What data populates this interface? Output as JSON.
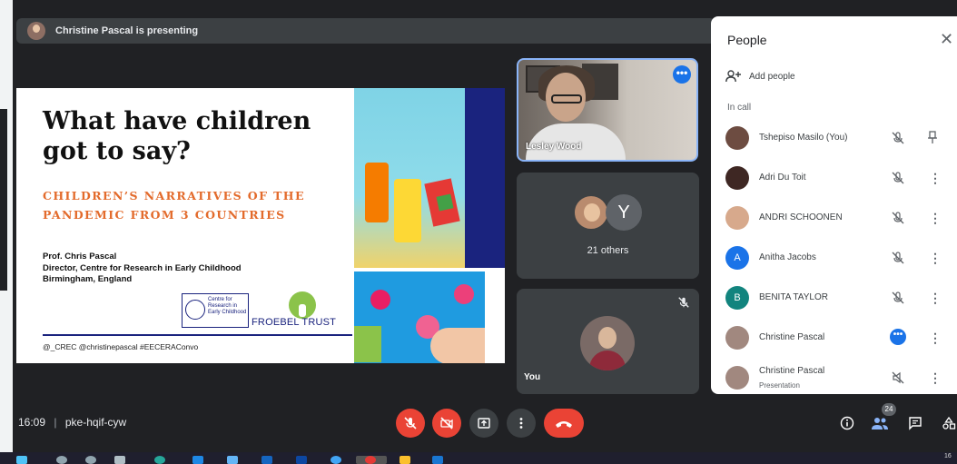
{
  "presenting_bar": {
    "text": "Christine Pascal is presenting"
  },
  "slide": {
    "title": "What have children got to say?",
    "subtitle": "CHILDREN’S NARRATIVES OF THE PANDEMIC FROM 3 COUNTRIES",
    "author_lines": [
      "Prof. Chris Pascal",
      "Director, Centre for Research in Early Childhood",
      "Birmingham, England"
    ],
    "crec_logo_text": "Centre for Research in Early Childhood",
    "froebel_text": "FROEBEL TRUST",
    "handles": "@_CREC @christinepascal #EECERAConvo"
  },
  "tiles": {
    "lesley": {
      "name": "Lesley Wood",
      "more_label": "•••"
    },
    "others": {
      "avatar_letter": "Y",
      "count_label": "21 others"
    },
    "you": {
      "name": "You"
    }
  },
  "people_panel": {
    "title": "People",
    "close_glyph": "✕",
    "add_label": "Add people",
    "section_label": "In call",
    "participants": [
      {
        "name": "Tshepiso Masilo (You)",
        "avatar": "photo",
        "avatar_color": "#6d4c41",
        "action": "pin-icon"
      },
      {
        "name": "Adri Du Toit",
        "avatar": "photo",
        "avatar_color": "#3e2723",
        "action": "more-vert-icon"
      },
      {
        "name": "ANDRI SCHOONEN",
        "avatar": "photo",
        "avatar_color": "#d7a98c",
        "action": "more-vert-icon"
      },
      {
        "name": "Anitha Jacobs",
        "avatar": "A",
        "avatar_color": "#1a73e8",
        "action": "more-vert-icon"
      },
      {
        "name": "BENITA TAYLOR",
        "avatar": "B",
        "avatar_color": "#12847e",
        "action": "more-vert-icon"
      },
      {
        "name": "Christine Pascal",
        "avatar": "photo",
        "avatar_color": "#a1887f",
        "action": "more-vert-icon",
        "speaking": true
      },
      {
        "name": "Christine Pascal",
        "sub": "Presentation",
        "avatar": "photo",
        "avatar_color": "#a1887f",
        "action": "more-vert-icon",
        "presentation": true
      }
    ]
  },
  "bottom_bar": {
    "time": "16:09",
    "separator": "|",
    "meeting_code": "pke-hqif-cyw",
    "people_count": "24"
  },
  "taskbar": {
    "clock": "16"
  },
  "colors": {
    "accent": "#1a73e8",
    "danger": "#ea4335",
    "surface": "#3c4043",
    "background": "#202124"
  }
}
